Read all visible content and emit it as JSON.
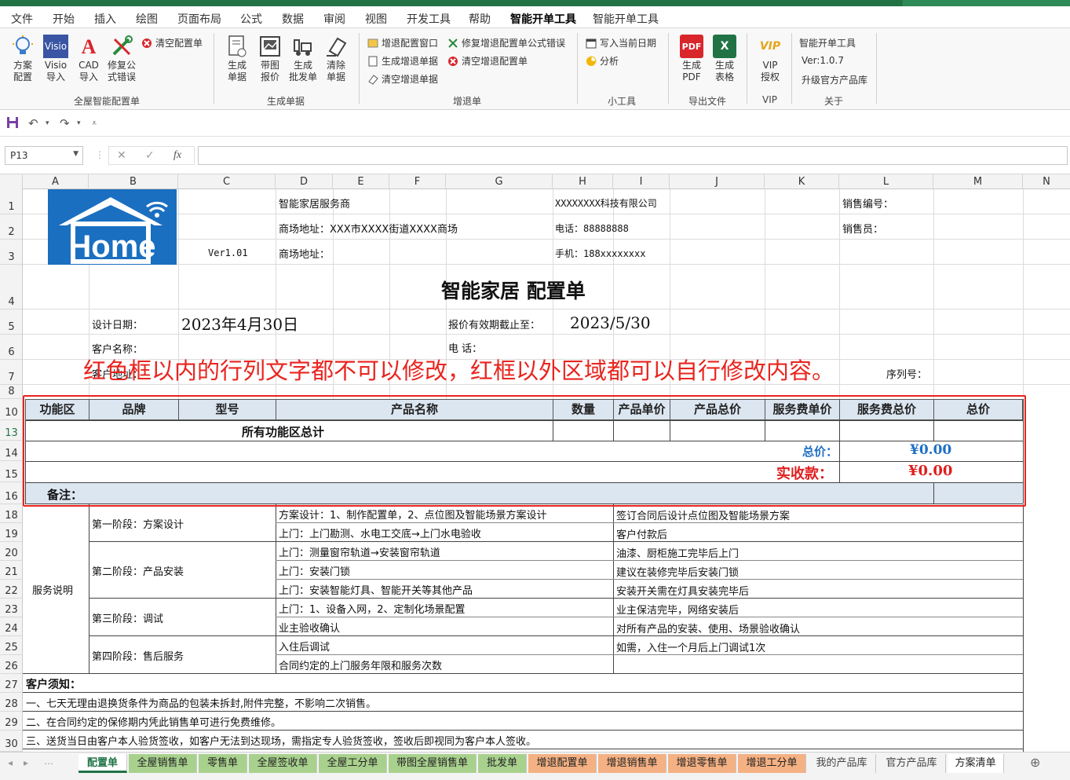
{
  "ribbon_tabs": [
    "文件",
    "开始",
    "插入",
    "绘图",
    "页面布局",
    "公式",
    "数据",
    "审阅",
    "视图",
    "开发工具",
    "帮助",
    "智能开单工具",
    "智能开单工具"
  ],
  "active_tab_index": 11,
  "groups": {
    "g1": {
      "label": "全屋智能配置单",
      "btn1": "方案\n配置",
      "btn1a": "方案",
      "btn1b": "配置",
      "btn2a": "Visio",
      "btn2b": "导入",
      "btn3a": "CAD",
      "btn3b": "导入",
      "btn4a": "修复公",
      "btn4b": "式错误",
      "small1": "清空配置单"
    },
    "g2": {
      "label": "生成单据",
      "b1a": "生成",
      "b1b": "单据",
      "b2a": "带图",
      "b2b": "报价",
      "b3a": "生成",
      "b3b": "批发单",
      "b4a": "清除",
      "b4b": "单据"
    },
    "g3": {
      "label": "增退单",
      "s1": "增退配置窗口",
      "s2": "修复增退配置单公式错误",
      "s3": "生成增退单据",
      "s4": "清空增退配置单",
      "s5": "清空增退单据"
    },
    "g4": {
      "label": "小工具",
      "s1": "写入当前日期",
      "s2": "分析"
    },
    "g5": {
      "label": "导出文件",
      "b1a": "生成",
      "b1b": "PDF",
      "b2a": "生成",
      "b2b": "表格",
      "pdf_icon_text": "PDF"
    },
    "g6": {
      "label": "VIP",
      "b1a": "VIP",
      "b1b": "授权",
      "icon_text": "VIP"
    },
    "g7": {
      "label": "关于",
      "t1": "智能开单工具",
      "t2": "Ver:1.0.7",
      "t3": "升级官方产品库"
    }
  },
  "name_box": "P13",
  "formula_icons": {
    "cancel": "✕",
    "enter": "✓",
    "fx": "fx"
  },
  "columns": [
    "A",
    "B",
    "C",
    "D",
    "E",
    "F",
    "G",
    "H",
    "I",
    "J",
    "K",
    "L",
    "M",
    "N"
  ],
  "rows": [
    "1",
    "2",
    "3",
    "4",
    "5",
    "6",
    "7",
    "8",
    "10",
    "13",
    "14",
    "15",
    "16",
    "18",
    "19",
    "20",
    "21",
    "22",
    "23",
    "24",
    "25",
    "26",
    "27",
    "28",
    "29",
    "30"
  ],
  "sheet": {
    "logo_text": "Home",
    "ver": "Ver1.01",
    "provider": "智能家居服务商",
    "mall_addr": "商场地址：XXX市XXXX街道XXXX商场",
    "mall_addr2": "商场地址：",
    "company": "XXXXXXXX科技有限公司",
    "phone": "电话：88888888",
    "mobile": "手机：188xxxxxxxx",
    "sales_no": "销售编号：",
    "salesman": "销售员：",
    "title": "智能家居  配置单",
    "design_date_label": "设计日期：",
    "design_date": "2023年4月30日",
    "valid_label": "报价有效期截止至：",
    "valid_date": "2023/5/30",
    "customer_label": "客户名称：",
    "tel_label": "电      话：",
    "addr_label": "客户地址：",
    "serial_label": "序列号：",
    "overlay": "红色框以内的行列文字都不可以修改，红框以外区域都可以自行修改内容。",
    "table_headers": [
      "功能区",
      "品牌",
      "型号",
      "产品名称",
      "数量",
      "产品单价",
      "产品总价",
      "服务费单价",
      "服务费总价",
      "总价"
    ],
    "all_total": "所有功能区总计",
    "total_label": "总价：",
    "total_value": "¥0.00",
    "received_label": "实收款：",
    "received_value": "¥0.00",
    "remark": "备注：",
    "service_label": "服务说明",
    "stage1": "第一阶段：方案设计",
    "stage2": "第二阶段：产品安装",
    "stage3": "第三阶段：调试",
    "stage4": "第四阶段：售后服务",
    "svc": [
      [
        "方案设计：1、制作配置单，2、点位图及智能场景方案设计",
        "签订合同后设计点位图及智能场景方案"
      ],
      [
        "上门：上门勘测、水电工交底→上门水电验收",
        "客户付款后"
      ],
      [
        "上门：测量窗帘轨道→安装窗帘轨道",
        "油漆、厨柜施工完毕后上门"
      ],
      [
        "上门：安装门锁",
        "建议在装修完毕后安装门锁"
      ],
      [
        "上门：安装智能灯具、智能开关等其他产品",
        "安装开关需在灯具安装完毕后"
      ],
      [
        "上门：1、设备入网，2、定制化场景配置",
        "业主保洁完毕，网络安装后"
      ],
      [
        "业主验收确认",
        "对所有产品的安装、使用、场景验收确认"
      ],
      [
        "入住后调试",
        "如需，入住一个月后上门调试1次"
      ],
      [
        "合同约定的上门服务年限和服务次数",
        ""
      ]
    ],
    "notice_title": "客户须知：",
    "notice1": "一、七天无理由退换货条件为商品的包装未拆封,附件完整，不影响二次销售。",
    "notice2": "二、在合同约定的保修期内凭此销售单可进行免费维修。",
    "notice3": "三、送货当日由客户本人验货签收，如客户无法到达现场，需指定专人验货签收，签收后即视同为客户本人签收。"
  },
  "sheet_tabs": [
    {
      "label": "配置单",
      "style": "active"
    },
    {
      "label": "全屋销售单",
      "style": "green"
    },
    {
      "label": "零售单",
      "style": "green"
    },
    {
      "label": "全屋签收单",
      "style": "green"
    },
    {
      "label": "全屋工分单",
      "style": "green"
    },
    {
      "label": "带图全屋销售单",
      "style": "green"
    },
    {
      "label": "批发单",
      "style": "green"
    },
    {
      "label": "增退配置单",
      "style": "orange"
    },
    {
      "label": "增退销售单",
      "style": "orange"
    },
    {
      "label": "增退零售单",
      "style": "orange"
    },
    {
      "label": "增退工分单",
      "style": "orange"
    },
    {
      "label": "我的产品库",
      "style": "plain"
    },
    {
      "label": "官方产品库",
      "style": "plain"
    },
    {
      "label": "方案清单",
      "style": "plain-white"
    }
  ],
  "colors": {
    "excel_green": "#217346",
    "red_box": "#e8251f",
    "header_fill": "#dce6f1",
    "total_blue": "#1f6fc5",
    "received_red": "#e01e1e"
  }
}
